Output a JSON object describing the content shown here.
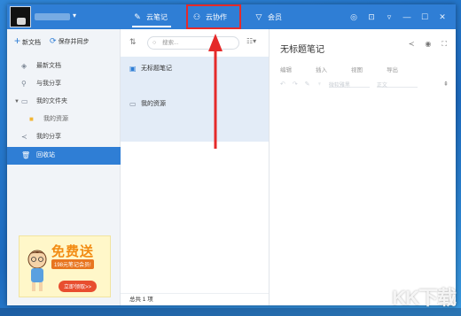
{
  "tabs": [
    {
      "label": "云笔记",
      "icon": "pencil-icon"
    },
    {
      "label": "云协作",
      "icon": "people-icon"
    },
    {
      "label": "会员",
      "icon": "diamond-icon"
    }
  ],
  "window_controls": [
    "skin-icon",
    "lock-icon",
    "menu-icon",
    "minimize-icon",
    "maximize-icon",
    "close-icon"
  ],
  "sidebar": {
    "new_doc": "新文档",
    "sync": "保存并同步",
    "items": [
      {
        "label": "最新文档"
      },
      {
        "label": "与我分享"
      },
      {
        "label": "我的文件夹"
      },
      {
        "label": "我的资源"
      },
      {
        "label": "我的分享"
      },
      {
        "label": "回收站"
      }
    ]
  },
  "ad": {
    "title": "免费送",
    "subtitle": "198元笔记会员!",
    "button": "立即领取>>"
  },
  "list": {
    "search_placeholder": "搜索...",
    "items": [
      {
        "label": "无标题笔记"
      },
      {
        "label": "我的资源"
      }
    ],
    "footer": "总共 1 项"
  },
  "editor": {
    "title": "无标题笔记",
    "menu": [
      "编辑",
      "插入",
      "视图",
      "导出"
    ],
    "font_select": "微软雅黑",
    "size_select": "正文"
  },
  "watermark": "KK下载",
  "colors": {
    "accent": "#2f7ed5",
    "highlight": "#e52a2a"
  }
}
